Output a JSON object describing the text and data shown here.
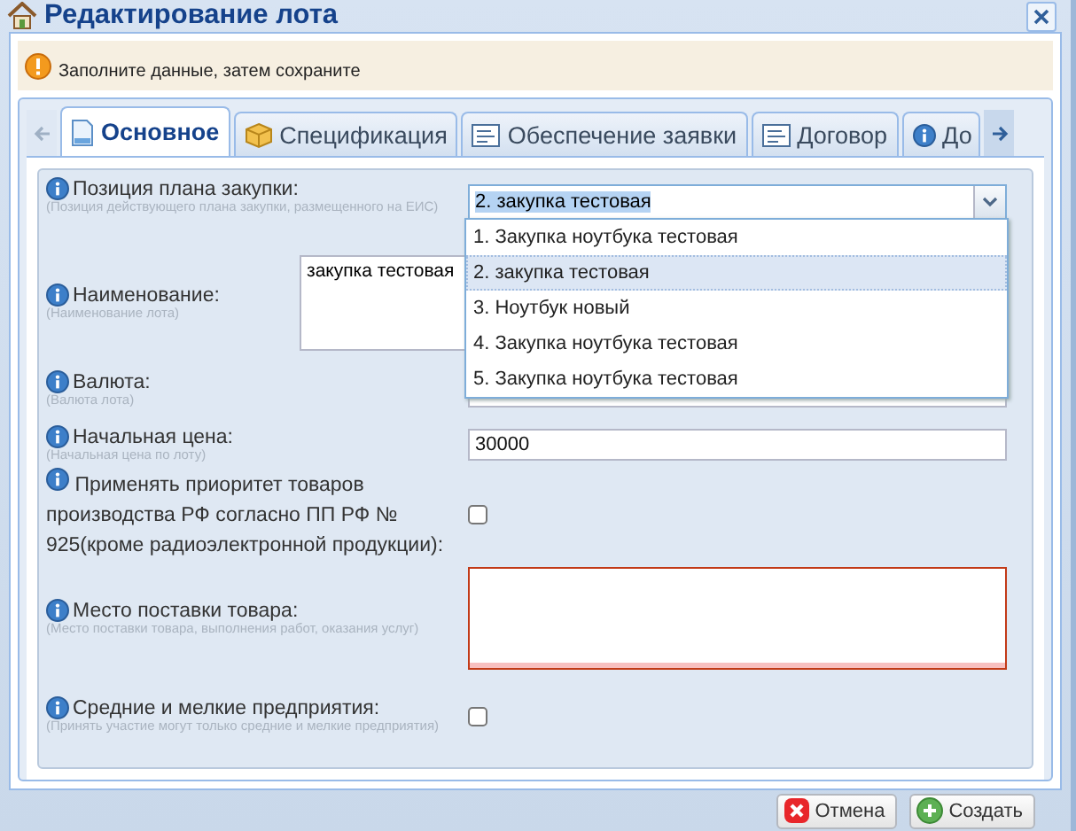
{
  "window": {
    "title": "Редактирование лота"
  },
  "notice": {
    "text": "Заполните данные, затем сохраните"
  },
  "tabs": [
    {
      "label": "Основное",
      "kind": "document",
      "selected": true
    },
    {
      "label": "Спецификация",
      "kind": "box",
      "selected": false
    },
    {
      "label": "Обеспечение заявки",
      "kind": "form",
      "selected": false
    },
    {
      "label": "Договор",
      "kind": "form",
      "selected": false
    },
    {
      "label": "До",
      "kind": "info",
      "selected": false
    }
  ],
  "fields": [
    {
      "kind": "combo",
      "label": "Позиция плана закупки:",
      "hint": "(Позиция действующего плана закупки, размещенного на ЕИС)",
      "value": "2. закупка тестовая"
    },
    {
      "kind": "textarea",
      "label": "Наименование:",
      "hint": "(Наименование лота)",
      "value": "закупка тестовая"
    },
    {
      "kind": "combo-covered",
      "label": "Валюта:",
      "hint": "(Валюта лота)"
    },
    {
      "kind": "text",
      "label": "Начальная цена:",
      "hint": "(Начальная цена по лоту)",
      "value": "30000"
    },
    {
      "kind": "checkbox",
      "label": "Применять приоритет товаров производства РФ согласно ПП РФ № 925(кроме радиоэлектронной продукции):",
      "checked": false
    },
    {
      "kind": "textarea-invalid",
      "label": "Место поставки товара:",
      "hint": "(Место поставки товара, выполнения работ, оказания услуг)"
    },
    {
      "kind": "checkbox",
      "label": "Средние и мелкие предприятия:",
      "hint": "(Принять участие могут только средние и мелкие предприятия)",
      "checked": false
    }
  ],
  "dropdown": {
    "options": [
      {
        "label": "1. Закупка ноутбука тестовая",
        "selected": false
      },
      {
        "label": "2. закупка тестовая",
        "selected": true
      },
      {
        "label": "3. Ноутбук новый",
        "selected": false
      },
      {
        "label": "4. Закупка ноутбука тестовая",
        "selected": false
      },
      {
        "label": "5. Закупка ноутбука тестовая",
        "selected": false
      }
    ]
  },
  "buttons": [
    {
      "label": "Отмена",
      "kind": "cancel"
    },
    {
      "label": "Создать",
      "kind": "create"
    }
  ]
}
